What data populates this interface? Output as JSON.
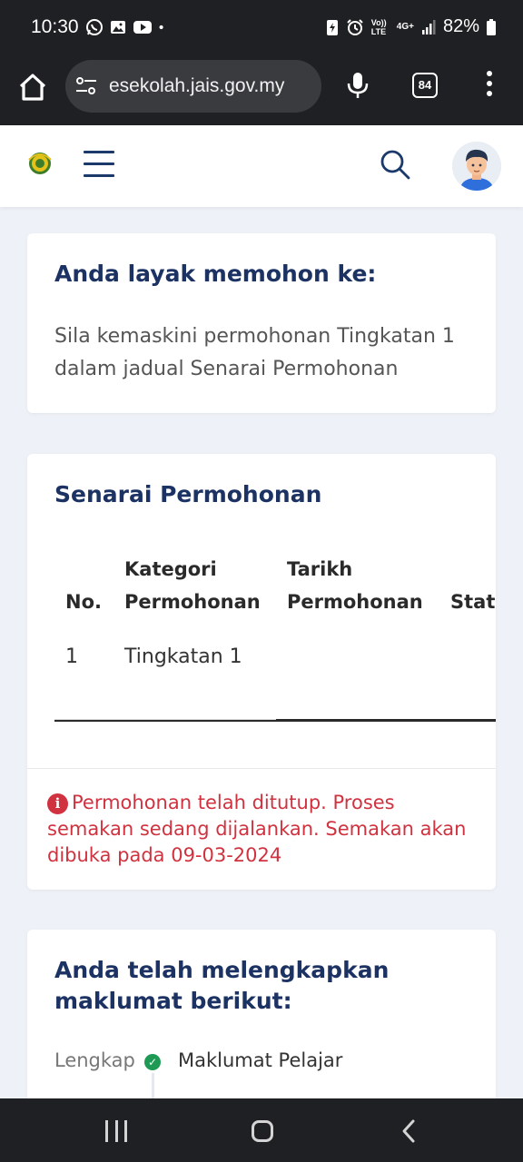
{
  "status_bar": {
    "time": "10:30",
    "notification_icons": [
      "whatsapp-icon",
      "gallery-icon",
      "youtube-icon",
      "dot-icon"
    ],
    "right_icons": [
      "battery-saver-icon",
      "alarm-icon",
      "volte-icon",
      "4g-icon",
      "signal-icon",
      "battery-icon"
    ],
    "volte_text": "Vo)) LTE",
    "network_text": "4G+",
    "battery": "82%"
  },
  "browser": {
    "url": "esekolah.jais.gov.my",
    "tab_count": "84"
  },
  "card1": {
    "title": "Anda layak memohon ke:",
    "text": "Sila kemaskini permohonan Tingkatan 1 dalam jadual Senarai Permohonan"
  },
  "card2": {
    "title": "Senarai Permohonan",
    "columns": {
      "no": "No.",
      "kategori": "Kategori Permohonan",
      "tarikh": "Tarikh Permohonan",
      "status": "Stat"
    },
    "rows": [
      {
        "no": "1",
        "kategori": "Tingkatan 1",
        "tarikh": "",
        "status": ""
      }
    ],
    "alert_text": "Permohonan telah ditutup. Proses semakan sedang dijalankan. Semakan akan dibuka pada 09-03-2024"
  },
  "card3": {
    "title": "Anda telah melengkapkan maklumat berikut:",
    "steps": [
      {
        "status": "Lengkap",
        "label": "Maklumat Pelajar"
      }
    ]
  },
  "colors": {
    "title_navy": "#1b3263",
    "alert_red": "#d0323f",
    "complete_green": "#1e9a55"
  }
}
